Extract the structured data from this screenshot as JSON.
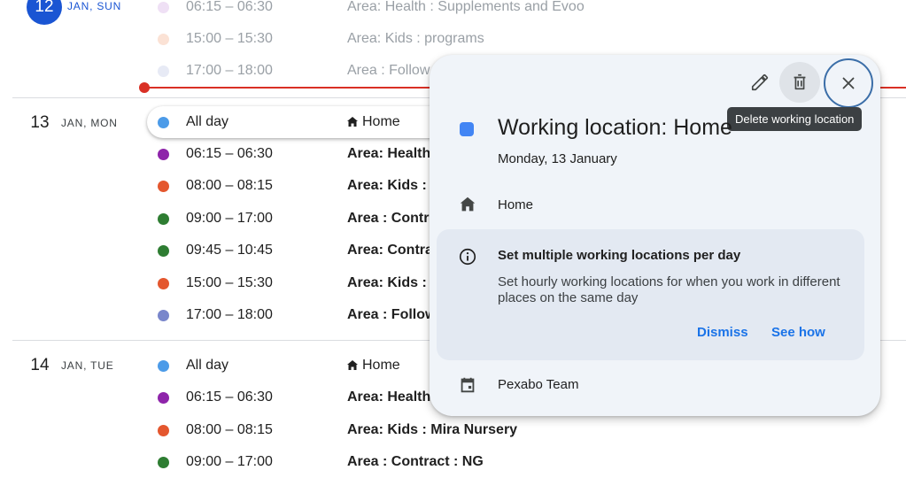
{
  "days": [
    {
      "num": "12",
      "label": "JAN, SUN",
      "events": [
        {
          "time": "06:15 – 06:30",
          "title": "Area: Health : Supplements and Evoo",
          "color": "#efe0f5",
          "past": true
        },
        {
          "time": "15:00 – 15:30",
          "title": "Area: Kids : programs",
          "color": "#fbe2d5",
          "past": true
        },
        {
          "time": "17:00 – 18:00",
          "title": "Area : Follow",
          "color": "#e7eaf5",
          "past": true
        }
      ]
    },
    {
      "num": "13",
      "label": "JAN, MON",
      "events": [
        {
          "time": "All day",
          "title": "Home",
          "color": "#4c9be8",
          "home": true
        },
        {
          "time": "06:15 – 06:30",
          "title": "Area: Health",
          "color": "#8e24aa"
        },
        {
          "time": "08:00 – 08:15",
          "title": "Area: Kids : I",
          "color": "#e4572e"
        },
        {
          "time": "09:00 – 17:00",
          "title": "Area : Contra",
          "color": "#2e7d32"
        },
        {
          "time": "09:45 – 10:45",
          "title": "Area: Contra",
          "color": "#2e7d32"
        },
        {
          "time": "15:00 – 15:30",
          "title": "Area: Kids : p",
          "color": "#e4572e"
        },
        {
          "time": "17:00 – 18:00",
          "title": "Area : Follow",
          "color": "#7986cb"
        }
      ]
    },
    {
      "num": "14",
      "label": "JAN, TUE",
      "events": [
        {
          "time": "All day",
          "title": "Home",
          "color": "#4c9be8",
          "home": true
        },
        {
          "time": "06:15 – 06:30",
          "title": "Area: Health",
          "color": "#8e24aa"
        },
        {
          "time": "08:00 – 08:15",
          "title": "Area: Kids : Mira Nursery",
          "color": "#e4572e"
        },
        {
          "time": "09:00 – 17:00",
          "title": "Area : Contract : NG",
          "color": "#2e7d32"
        }
      ]
    }
  ],
  "popup": {
    "title": "Working location: Home",
    "date": "Monday, 13 January",
    "location": "Home",
    "tooltip": "Delete working location",
    "info_title": "Set multiple working locations per day",
    "info_body": "Set hourly working locations for when you work in different places on the same day",
    "dismiss_label": "Dismiss",
    "see_how_label": "See how",
    "calendar_name": "Pexabo Team",
    "accent_color": "#4285f4"
  },
  "icons": [
    "pencil-icon",
    "trash-icon",
    "close-icon",
    "home-icon",
    "info-icon",
    "calendar-icon"
  ]
}
